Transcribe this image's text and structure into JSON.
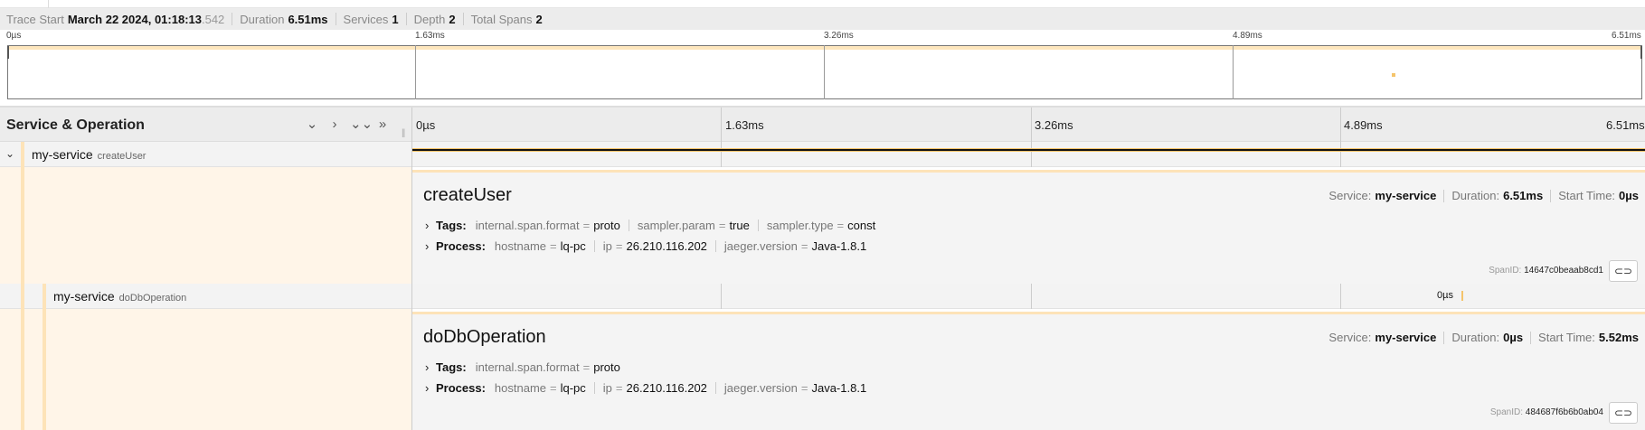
{
  "trace_summary": {
    "trace_start_label": "Trace Start",
    "trace_start_value": "March 22 2024, 01:18:13",
    "trace_start_ms": ".542",
    "duration_label": "Duration",
    "duration_value": "6.51ms",
    "services_label": "Services",
    "services_value": "1",
    "depth_label": "Depth",
    "depth_value": "2",
    "total_spans_label": "Total Spans",
    "total_spans_value": "2"
  },
  "minimap": {
    "ticks": [
      "0µs",
      "1.63ms",
      "3.26ms",
      "4.89ms",
      "6.51ms"
    ]
  },
  "header": {
    "title": "Service & Operation",
    "ticks": [
      "0µs",
      "1.63ms",
      "3.26ms",
      "4.89ms",
      "6.51ms"
    ],
    "icons": [
      "chevron-down-icon",
      "chevron-right-icon",
      "double-chevron-down-icon",
      "double-chevron-right-icon"
    ]
  },
  "spans": [
    {
      "service": "my-service",
      "operation": "createUser",
      "bar_label": "",
      "detail": {
        "title": "createUser",
        "service_label": "Service:",
        "service_value": "my-service",
        "duration_label": "Duration:",
        "duration_value": "6.51ms",
        "start_label": "Start Time:",
        "start_value": "0µs",
        "tags_label": "Tags:",
        "tags": [
          {
            "k": "internal.span.format",
            "v": "proto"
          },
          {
            "k": "sampler.param",
            "v": "true"
          },
          {
            "k": "sampler.type",
            "v": "const"
          }
        ],
        "process_label": "Process:",
        "process": [
          {
            "k": "hostname",
            "v": "lq-pc"
          },
          {
            "k": "ip",
            "v": "26.210.116.202"
          },
          {
            "k": "jaeger.version",
            "v": "Java-1.8.1"
          }
        ],
        "spanid_label": "SpanID:",
        "spanid_value": "14647c0beaab8cd1"
      }
    },
    {
      "service": "my-service",
      "operation": "doDbOperation",
      "bar_label": "0µs",
      "detail": {
        "title": "doDbOperation",
        "service_label": "Service:",
        "service_value": "my-service",
        "duration_label": "Duration:",
        "duration_value": "0µs",
        "start_label": "Start Time:",
        "start_value": "5.52ms",
        "tags_label": "Tags:",
        "tags": [
          {
            "k": "internal.span.format",
            "v": "proto"
          }
        ],
        "process_label": "Process:",
        "process": [
          {
            "k": "hostname",
            "v": "lq-pc"
          },
          {
            "k": "ip",
            "v": "26.210.116.202"
          },
          {
            "k": "jaeger.version",
            "v": "Java-1.8.1"
          }
        ],
        "spanid_label": "SpanID:",
        "spanid_value": "484687f6b6b0ab04"
      }
    }
  ],
  "colors": {
    "span_bar": "#111111",
    "span_bar_accent": "#f5c46b",
    "lane": "#fde3b8",
    "detail_left_bg": "#fff5e8"
  }
}
